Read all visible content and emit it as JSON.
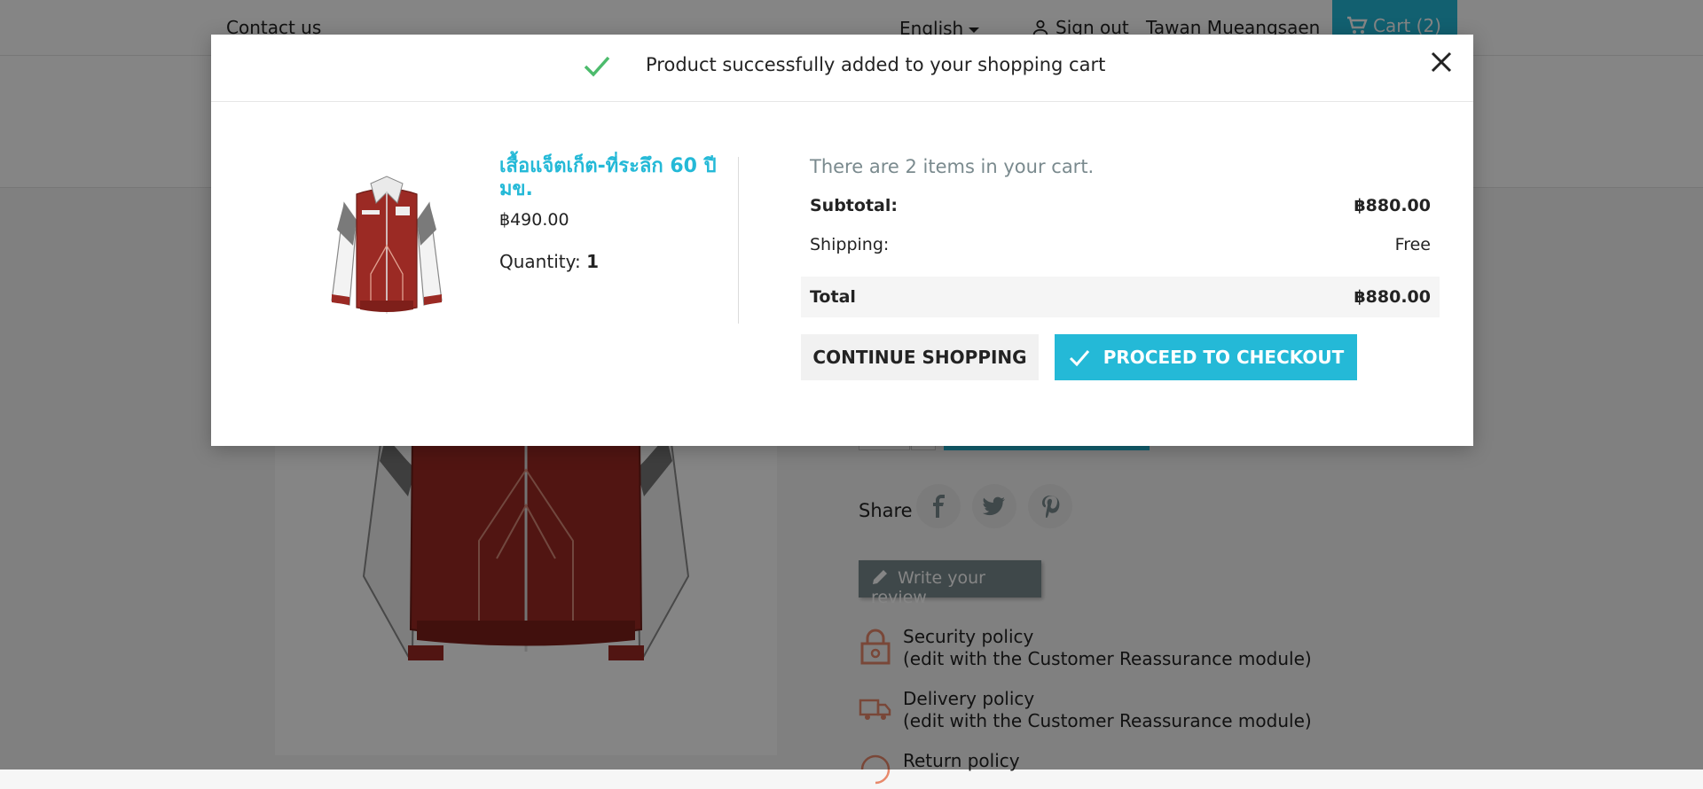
{
  "header": {
    "contact_label": "Contact us",
    "language_label": "English",
    "signout_label": "Sign out",
    "user_name": "Tawan Mueangsaen",
    "cart_label": "Cart (2)"
  },
  "product_page": {
    "share_label": "Share",
    "review_label": "Write your review",
    "reassurance": [
      {
        "title": "Security policy",
        "note": "(edit with the Customer Reassurance module)",
        "icon": "lock-icon"
      },
      {
        "title": "Delivery policy",
        "note": "(edit with the Customer Reassurance module)",
        "icon": "truck-icon"
      },
      {
        "title": "Return policy",
        "icon": "return-icon"
      }
    ]
  },
  "modal": {
    "title": "Product successfully added to your shopping cart",
    "product": {
      "name": "เสื้อแจ็ตเก็ต-ที่ระลึก 60 ปี มข.",
      "price": "฿490.00",
      "quantity_label": "Quantity:",
      "quantity_value": "1"
    },
    "cart": {
      "count_text": "There are 2 items in your cart.",
      "subtotal_label": "Subtotal:",
      "subtotal_value": "฿880.00",
      "shipping_label": "Shipping:",
      "shipping_value": "Free",
      "total_label": "Total",
      "total_value": "฿880.00"
    },
    "buttons": {
      "continue": "CONTINUE SHOPPING",
      "checkout": "PROCEED TO CHECKOUT"
    }
  },
  "colors": {
    "accent": "#24b9d7",
    "success": "#4cbb6c",
    "jacket_red": "#9b2a24"
  }
}
